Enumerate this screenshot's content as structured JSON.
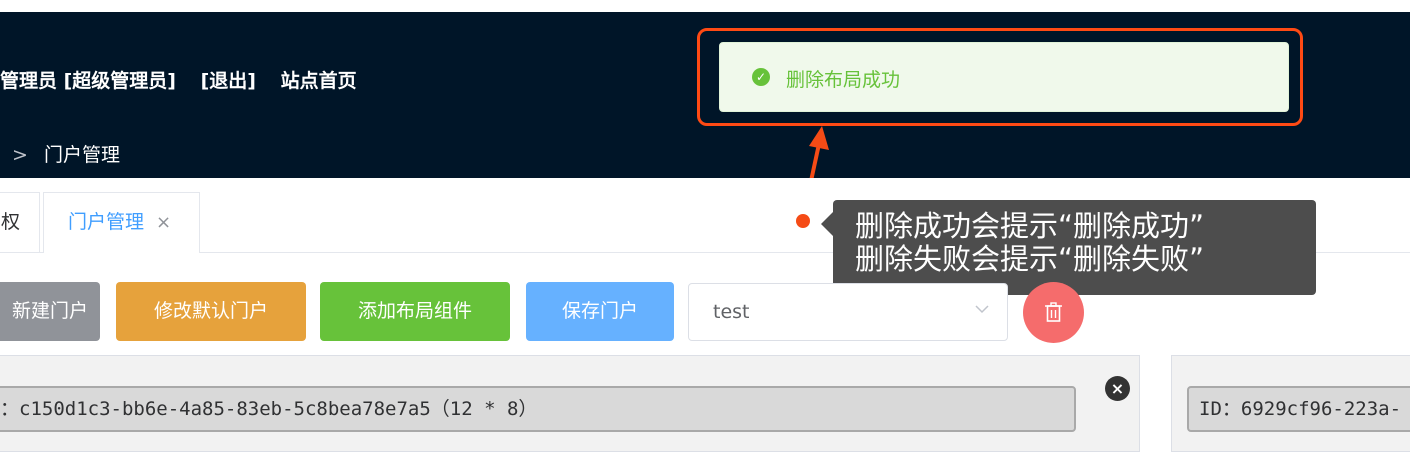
{
  "header": {
    "user": "管理员 [超级管理员]",
    "logout": "[退出]",
    "home": "站点首页",
    "breadcrumb_prev": "",
    "breadcrumb_sep": ">",
    "breadcrumb_current": "门户管理"
  },
  "toast": {
    "message": "删除布局成功",
    "status_color": "#67c23a",
    "highlight_color": "#ff4a14"
  },
  "tabs": [
    {
      "label": "权"
    },
    {
      "label": "门户管理",
      "close": "×",
      "active": true
    }
  ],
  "annotation": {
    "line1": "删除成功会提示“删除成功”",
    "line2": "删除失败会提示“删除失败”"
  },
  "toolbar": {
    "new_label": "新建门户",
    "default_label": "修改默认门户",
    "add_label": "添加布局组件",
    "save_label": "保存门户",
    "select_value": "test",
    "delete_icon": "trash-icon"
  },
  "panels": {
    "left_id": "：c150d1c3-bb6e-4a85-83eb-5c8bea78e7a5（12 * 8）",
    "right_id": "ID：6929cf96-223a-",
    "close_symbol": "×"
  }
}
